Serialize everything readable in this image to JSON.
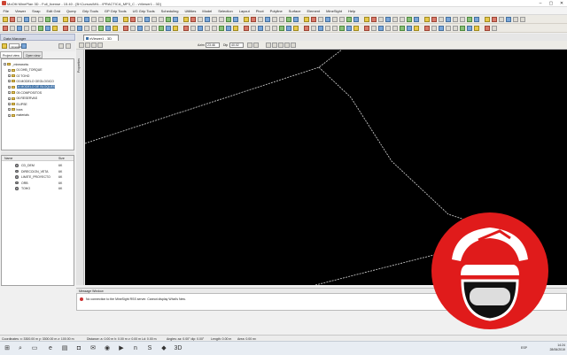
{
  "window": {
    "title": "MoOlti MinePlan 3D - Full_license - 15.40 - [B:\\Cursos\\MIL...\\PRACTICA_MP3_C - vViewer1 - 3D]",
    "minimize_glyph": "–",
    "maximize_glyph": "▢",
    "close_glyph": "✕"
  },
  "menu": [
    "File",
    "Viewer",
    "Snap",
    "Edit Grid",
    "Query",
    "Grip Tools",
    "GP Grip Tools",
    "UG Grip Tools",
    "Scheduling",
    "Utilities",
    "Model",
    "Selection",
    "Layout",
    "Pivot",
    "Polyline",
    "Surface",
    "Element",
    "MineSight",
    "Help"
  ],
  "data_manager": {
    "title": "Data Manager",
    "search_value": "mineworks",
    "tabs": [
      "Project view",
      "Open view"
    ],
    "tree": [
      {
        "label": "_mineworks",
        "level": 0,
        "expanded": true,
        "selected": false
      },
      {
        "label": "01 DHB_TORQUE",
        "level": 1,
        "selected": false
      },
      {
        "label": "02 TOHO",
        "level": 1,
        "selected": false
      },
      {
        "label": "03 MODELO GEOLOGICO",
        "level": 1,
        "selected": false
      },
      {
        "label": "04 MODELO DE BLOQUES",
        "level": 1,
        "selected": true
      },
      {
        "label": "05 COMPOSITOS",
        "level": 1,
        "selected": false
      },
      {
        "label": "06 RESERVAS",
        "level": 1,
        "selected": false
      },
      {
        "label": "ELIPSE",
        "level": 1,
        "selected": false
      },
      {
        "label": "bora",
        "level": 1,
        "selected": false
      },
      {
        "label": "materials",
        "level": 1,
        "selected": false
      }
    ],
    "file_columns": {
      "name": "Name",
      "size": "Size"
    },
    "files": [
      {
        "name": "CD_DEM",
        "size": "6K"
      },
      {
        "name": "DIRECCION_VETA",
        "size": "6K"
      },
      {
        "name": "LIMITE_PROYECTO",
        "size": "6K"
      },
      {
        "name": "ORB",
        "size": "6K"
      },
      {
        "name": "TOHO",
        "size": "6K"
      }
    ]
  },
  "viewer": {
    "tab_label": "vViewer1 - 3D",
    "azimuth_label": "Azim",
    "azimuth_value": "23.46",
    "dip_label": "Dip",
    "dip_value": "40.02",
    "side_tab": "Properties"
  },
  "message_window": {
    "title": "Message Window",
    "message": "No connection to the MineSight RSS server. Cannot display What's New."
  },
  "status": {
    "coordinates": "Coordinates: x: 3300.00 m  y: 3300.00 m  z: 100.00 m",
    "distance": "Distance: a: 0.00 m  h: 0.00 m  v: 0.00 m  Ld: 0.00 m",
    "angles": "Angles: az: 0.00°  dip: 0.00°",
    "length": "Length: 0.00 m",
    "area": "Area: 0.00 m²"
  },
  "taskbar": {
    "lang": "ESP",
    "time": "14:24",
    "date": "28/06/2019"
  },
  "colors": {
    "viewport_bg": "#000000",
    "wireframe": "#d8d8d8",
    "logo_red": "#e01b1b",
    "selection": "#3a6ea5"
  }
}
